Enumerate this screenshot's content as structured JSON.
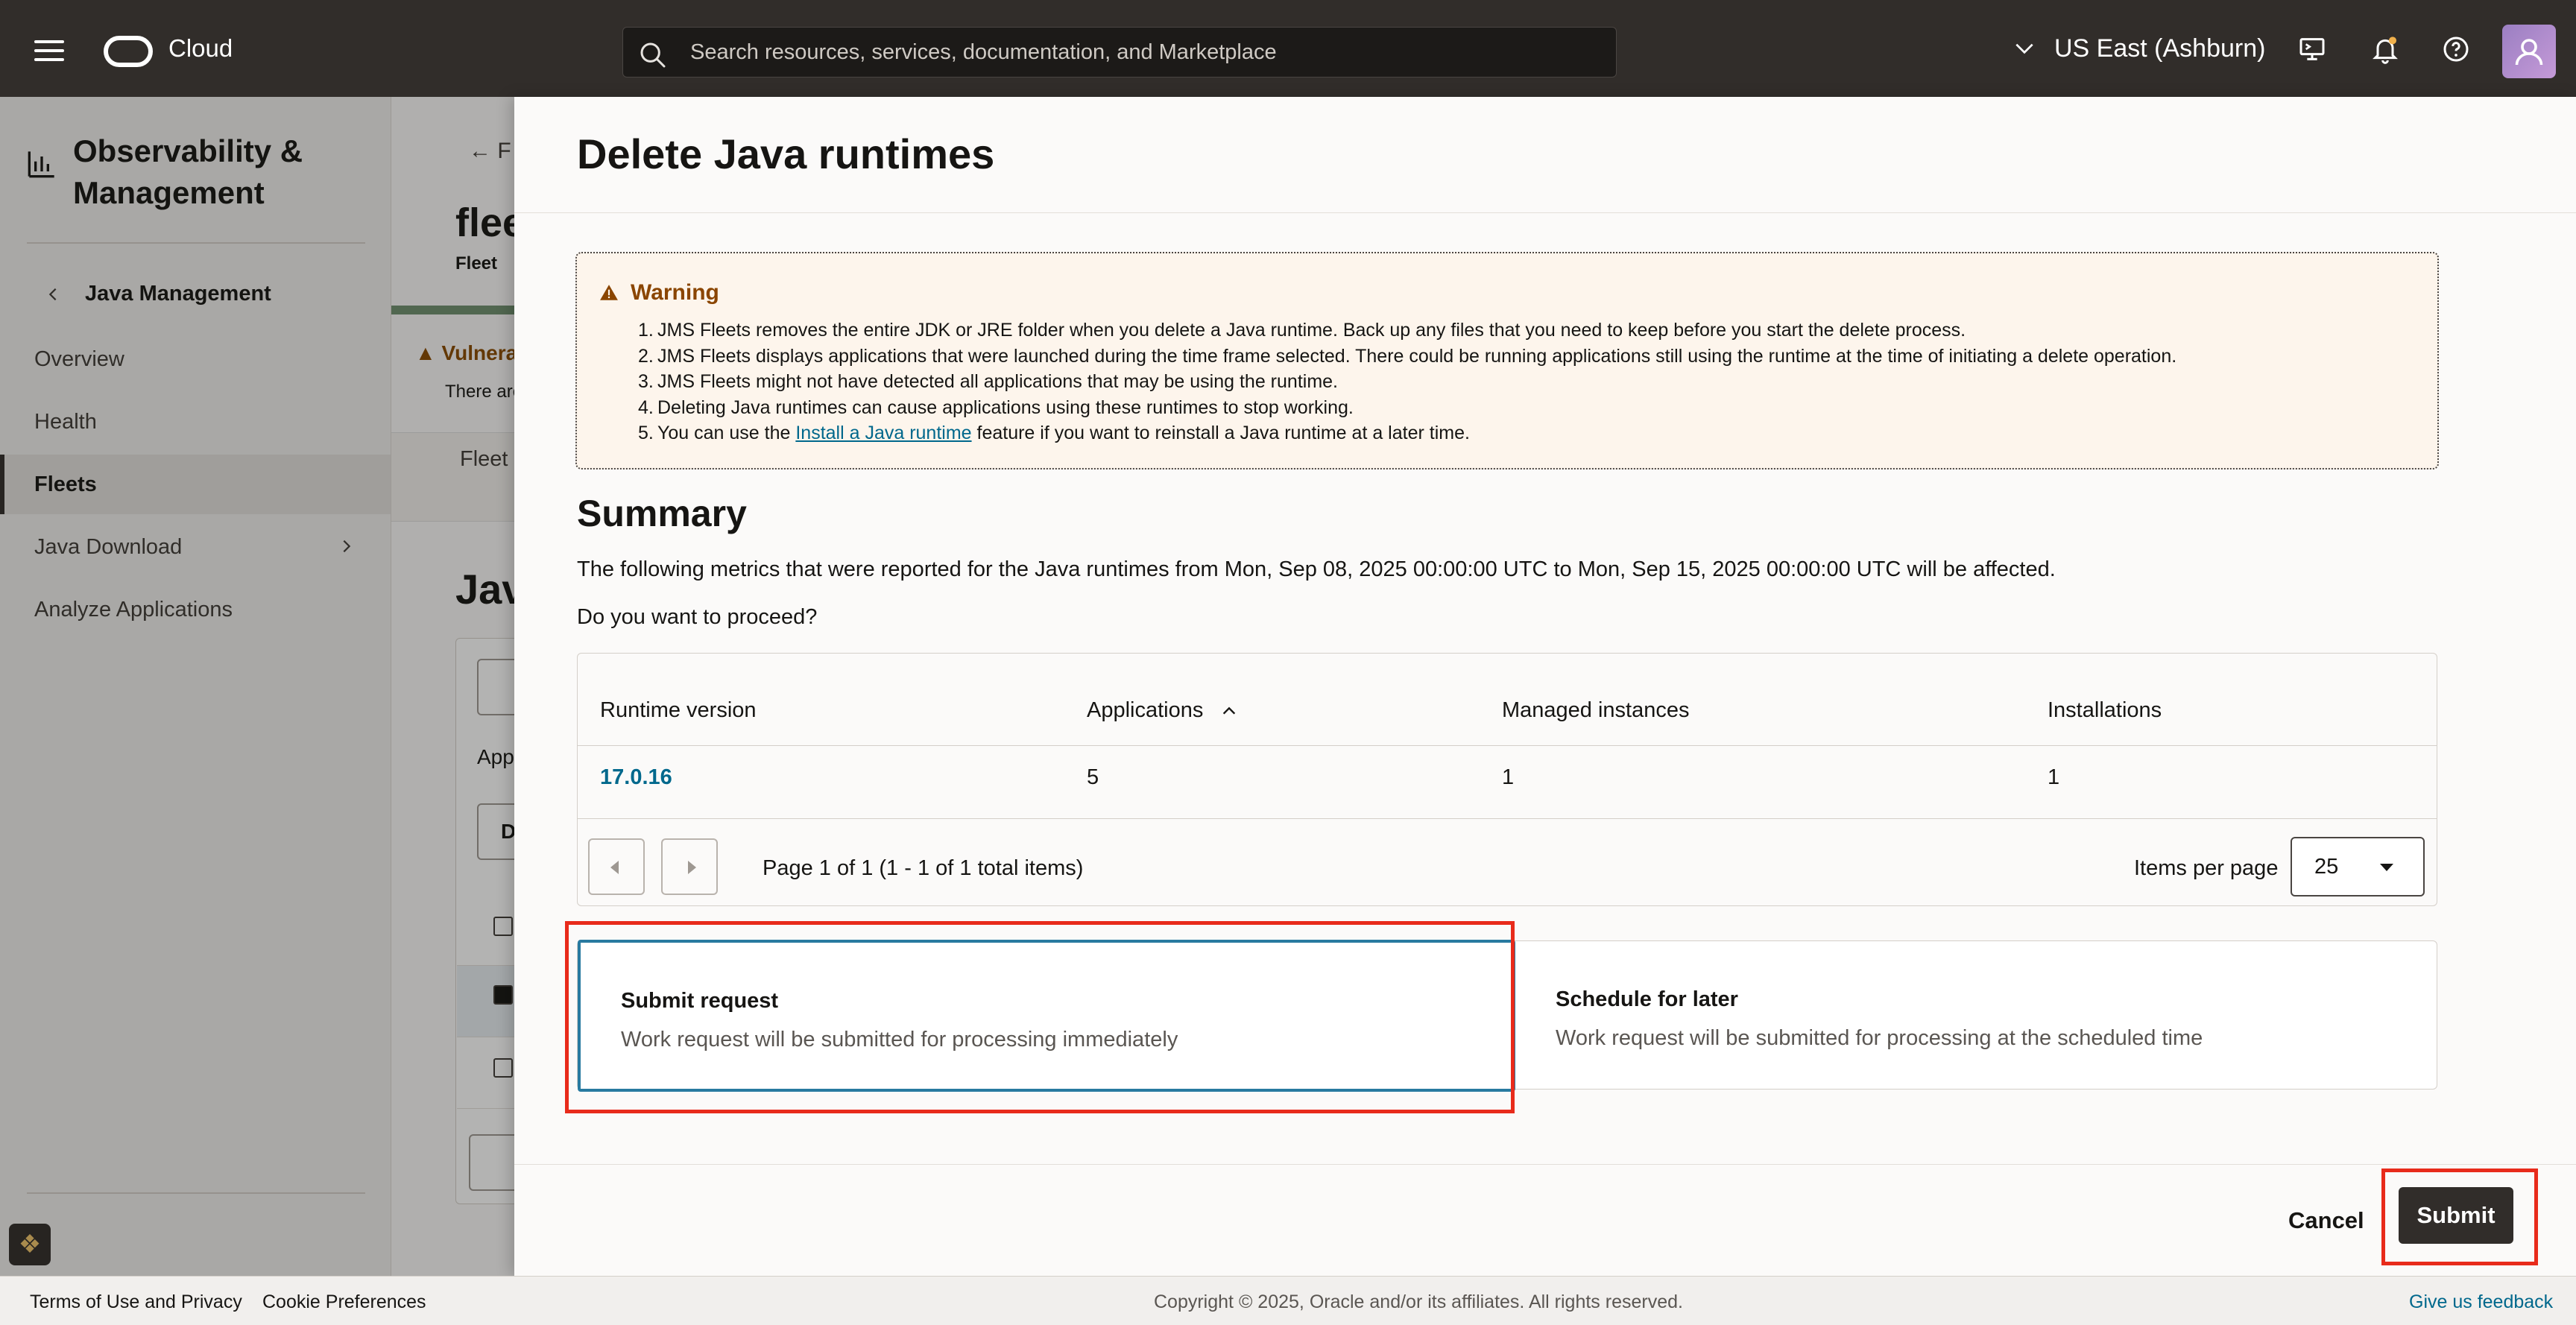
{
  "header": {
    "brand": "Cloud",
    "search_placeholder": "Search resources, services, documentation, and Marketplace",
    "region": "US East (Ashburn)",
    "icons": [
      "menu-icon",
      "oracle-logo-icon",
      "search-icon",
      "chevron-down-icon",
      "cloud-shell-icon",
      "bell-icon",
      "help-icon",
      "user-avatar-icon"
    ]
  },
  "sidebar": {
    "service_title": "Observability & Management",
    "back_label": "Java Management",
    "items": [
      {
        "label": "Overview",
        "active": false
      },
      {
        "label": "Health",
        "active": false
      },
      {
        "label": "Fleets",
        "active": true
      },
      {
        "label": "Java Download",
        "active": false,
        "has_submenu": true
      },
      {
        "label": "Analyze Applications",
        "active": false
      }
    ]
  },
  "background_page": {
    "back_link": "F",
    "title": "flee",
    "subtitle": "Fleet",
    "vuln_label": "Vulnera",
    "vuln_text": "There are",
    "tab": "Fleet",
    "section_title": "Jav",
    "filter_label": "App",
    "dropdown_letter": "D"
  },
  "drawer": {
    "title": "Delete Java runtimes",
    "warning": {
      "title": "Warning",
      "items": [
        {
          "num": "1.",
          "text": "JMS Fleets removes the entire JDK or JRE folder when you delete a Java runtime. Back up any files that you need to keep before you start the delete process."
        },
        {
          "num": "2.",
          "text": "JMS Fleets displays applications that were launched during the time frame selected. There could be running applications still using the runtime at the time of initiating a delete operation."
        },
        {
          "num": "3.",
          "text": "JMS Fleets might not have detected all applications that may be using the runtime."
        },
        {
          "num": "4.",
          "text": "Deleting Java runtimes can cause applications using these runtimes to stop working."
        }
      ],
      "item5": {
        "num": "5.",
        "prefix": "You can use the ",
        "link": "Install a Java runtime",
        "suffix": " feature if you want to reinstall a Java runtime at a later time."
      }
    },
    "summary": {
      "title": "Summary",
      "description": "The following metrics that were reported for the Java runtimes from Mon, Sep 08, 2025 00:00:00 UTC to Mon, Sep 15, 2025 00:00:00 UTC will be affected.",
      "question": "Do you want to proceed?"
    },
    "table": {
      "columns": [
        "Runtime version",
        "Applications",
        "Managed instances",
        "Installations"
      ],
      "sorted_column": "Applications",
      "rows": [
        [
          "17.0.16",
          "5",
          "1",
          "1"
        ]
      ],
      "pagination": "Page 1 of 1 (1 - 1 of 1 total items)",
      "items_per_page_label": "Items per page",
      "items_per_page": "25"
    },
    "options": [
      {
        "title": "Submit request",
        "desc": "Work request will be submitted for processing immediately",
        "selected": true
      },
      {
        "title": "Schedule for later",
        "desc": "Work request will be submitted for processing at the scheduled time",
        "selected": false
      }
    ],
    "cancel_label": "Cancel",
    "submit_label": "Submit"
  },
  "footer": {
    "terms": "Terms of Use and Privacy",
    "cookies": "Cookie Preferences",
    "copyright": "Copyright © 2025, Oracle and/or its affiliates. All rights reserved.",
    "feedback": "Give us feedback"
  },
  "colors": {
    "header_bg": "#312d2a",
    "link": "#00688c",
    "selected_border": "#287aa0",
    "annotation_red": "#e82b1b",
    "warning_bg": "#fdf5ec",
    "warning_text": "#8a4500"
  }
}
